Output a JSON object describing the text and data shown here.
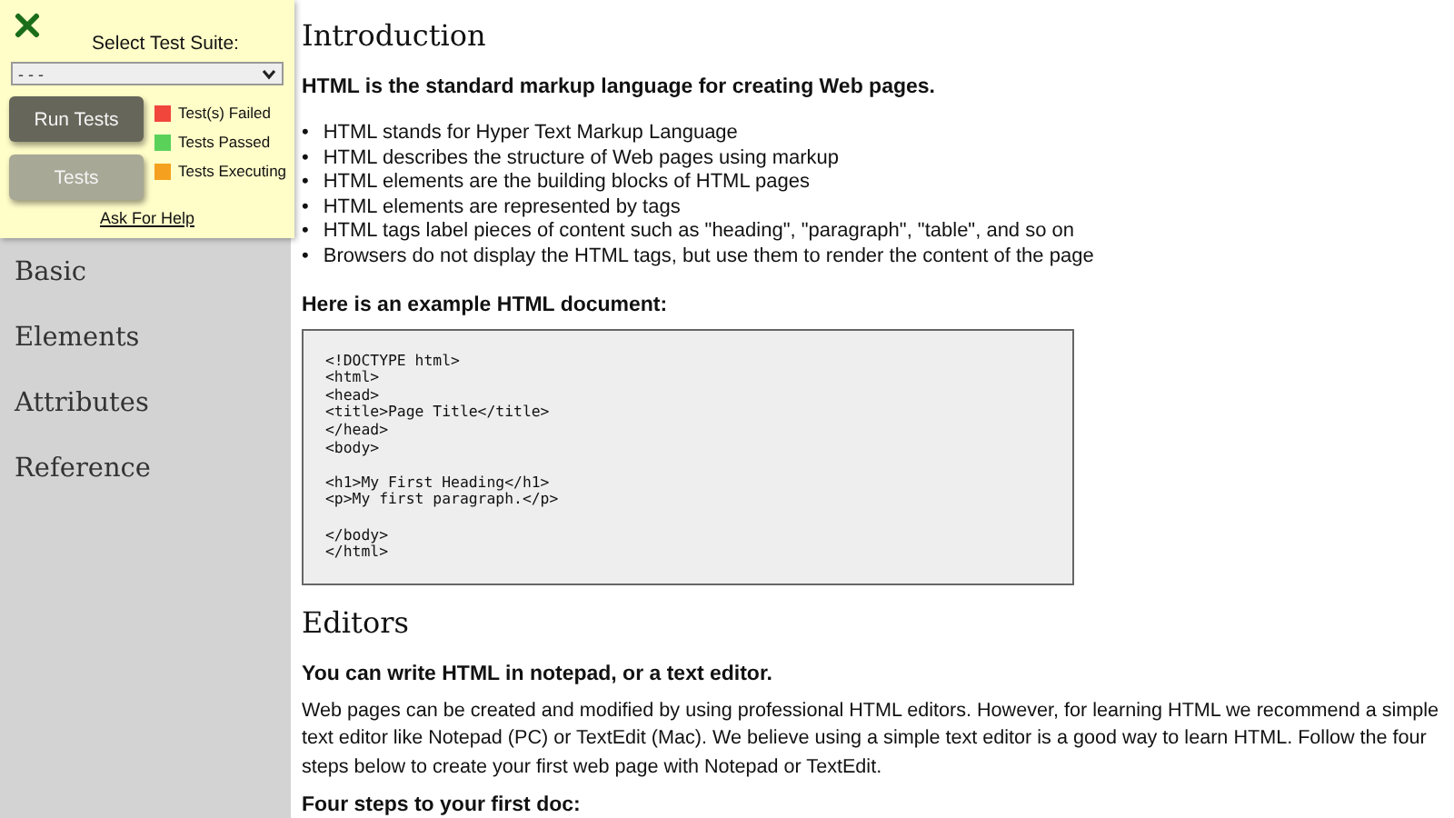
{
  "sidebar": {
    "items": [
      {
        "label": "Basic"
      },
      {
        "label": "Elements"
      },
      {
        "label": "Attributes"
      },
      {
        "label": "Reference"
      }
    ]
  },
  "test_panel": {
    "label": "Select Test Suite:",
    "select": {
      "value": "- - -"
    },
    "buttons": [
      {
        "label": "Run Tests",
        "disabled": false
      },
      {
        "label": "Tests",
        "disabled": true
      }
    ],
    "legend": [
      {
        "label": "Test(s) Failed",
        "color": "#f0463c"
      },
      {
        "label": "Tests Passed",
        "color": "#5ad25a"
      },
      {
        "label": "Tests Executing",
        "color": "#f5a01e"
      }
    ],
    "help_link": "Ask For Help"
  },
  "sections": [
    {
      "heading": "Introduction",
      "blocks": [
        {
          "kind": "lead",
          "text": "HTML is the standard markup language for creating Web pages."
        },
        {
          "kind": "list",
          "marker": "•",
          "items": [
            "HTML stands for Hyper Text Markup Language",
            "HTML describes the structure of Web pages using markup",
            "HTML elements are the building blocks of HTML pages",
            "HTML elements are represented by tags",
            "HTML tags label pieces of content such as \"heading\", \"paragraph\", \"table\", and so on",
            "Browsers do not display the HTML tags, but use them to render the content of the page"
          ]
        },
        {
          "kind": "lead",
          "text": "Here is an example HTML document:"
        },
        {
          "kind": "code",
          "groups": [
            [
              "<!DOCTYPE html>",
              "<html>",
              "<head>",
              "<title>Page Title</title>",
              "</head>",
              "<body>"
            ],
            [
              "<h1>My First Heading</h1>",
              "<p>My first paragraph.</p>"
            ],
            [
              "</body>",
              "</html>"
            ]
          ]
        }
      ]
    },
    {
      "heading": "Editors",
      "blocks": [
        {
          "kind": "lead",
          "text": "You can write HTML in notepad, or a text editor."
        },
        {
          "kind": "para",
          "text": "Web pages can be created and modified by using professional HTML editors. However, for learning HTML we recommend a simple text editor like Notepad (PC) or TextEdit (Mac). We believe using a simple text editor is a good way to learn HTML. Follow the four steps below to create your first web page with Notepad or TextEdit."
        },
        {
          "kind": "lead",
          "text": "Four steps to your first doc:"
        }
      ]
    }
  ]
}
